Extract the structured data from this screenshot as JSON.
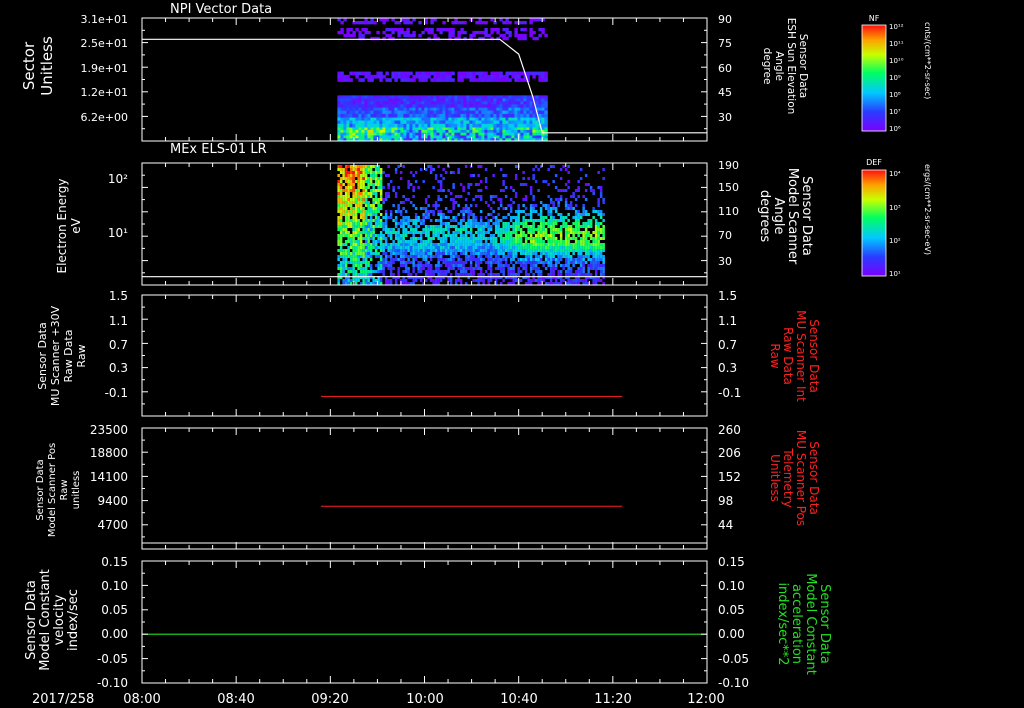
{
  "footer": {
    "date_label": "2017/258",
    "time_ticks": [
      "08:00",
      "08:40",
      "09:20",
      "10:00",
      "10:40",
      "11:20",
      "12:00"
    ]
  },
  "panels": [
    {
      "title": "NPI Vector Data",
      "left_label": [
        "Sector",
        "Unitless"
      ],
      "left_ticks": [
        "3.1e+01",
        "2.5e+01",
        "1.9e+01",
        "1.2e+01",
        "6.2e+00"
      ],
      "right_label": [
        "Sensor Data",
        "ESH Sun Elevation",
        "Angle",
        "degree"
      ],
      "right_ticks": [
        "90",
        "75",
        "60",
        "45",
        "30"
      ],
      "colorbar": {
        "label": "NF",
        "unit": "cnts/(cm**2-sr-sec)",
        "ticks": [
          "10¹²",
          "10¹¹",
          "10¹⁰",
          "10⁹",
          "10⁸",
          "10⁷",
          "10⁶"
        ]
      }
    },
    {
      "title": "MEx ELS-01 LR",
      "left_label": [
        "Electron Energy",
        "eV"
      ],
      "left_ticks": [
        "10²",
        "10¹"
      ],
      "right_label": [
        "Sensor Data",
        "Model Scanner",
        "Angle",
        "degrees"
      ],
      "right_ticks": [
        "190",
        "150",
        "110",
        "70",
        "30"
      ],
      "colorbar": {
        "label": "DEF",
        "unit": "ergs/(cm**2-sr-sec-eV)",
        "ticks": [
          "10⁴",
          "10³",
          "10²",
          "10¹"
        ]
      }
    },
    {
      "left_label": [
        "Sensor Data",
        "MU Scanner +30V",
        "Raw Data",
        "Raw"
      ],
      "left_ticks": [
        "1.5",
        "1.1",
        "0.7",
        "0.3",
        "-0.1"
      ],
      "right_label": [
        "Sensor Data",
        "MU Scanner Int",
        "Raw Data",
        "Raw"
      ],
      "right_ticks": [
        "1.5",
        "1.1",
        "0.7",
        "0.3",
        "-0.1"
      ]
    },
    {
      "left_label": [
        "Sensor Data",
        "Model Scanner Pos",
        "Raw",
        "unitless"
      ],
      "left_ticks": [
        "23500",
        "18800",
        "14100",
        "9400",
        "4700"
      ],
      "right_label": [
        "Sensor Data",
        "MU Scanner Pos",
        "Telemetry",
        "Unitless"
      ],
      "right_ticks": [
        "260",
        "206",
        "152",
        "98",
        "44"
      ]
    },
    {
      "left_label": [
        "Sensor Data",
        "Model Constant",
        "velocity",
        "index/sec"
      ],
      "left_ticks": [
        "0.15",
        "0.10",
        "0.05",
        "0.00",
        "-0.05",
        "-0.10"
      ],
      "right_label": [
        "Sensor Data",
        "Model Constant",
        "acceleration",
        "index/sec**2"
      ],
      "right_ticks": [
        "0.15",
        "0.10",
        "0.05",
        "0.00",
        "-0.05",
        "-0.10"
      ]
    }
  ],
  "colors": {
    "red_series": "#ff2020",
    "green_series": "#22e022",
    "white_series": "#ffffff"
  },
  "chart_data": [
    {
      "type": "heatmap",
      "x_range": [
        "08:00",
        "12:00"
      ],
      "ylim": [
        0,
        31
      ],
      "data_time_range": [
        "09:23",
        "10:52"
      ],
      "overlay_line": {
        "name": "ESH Sun Elevation Angle",
        "y2lim": [
          15,
          90
        ],
        "x": [
          "08:00",
          "10:32",
          "10:40",
          "10:46",
          "10:50",
          "12:00"
        ],
        "y": [
          77,
          77,
          68,
          42,
          20,
          20
        ]
      }
    },
    {
      "type": "heatmap",
      "x_range": [
        "08:00",
        "12:00"
      ],
      "y_log": true,
      "ylim": [
        2,
        180
      ],
      "data_time_range": [
        "09:23",
        "11:16"
      ],
      "overlay_line": {
        "name": "Model Scanner Angle",
        "y2lim": [
          0,
          190
        ],
        "x": [
          "08:00",
          "12:00"
        ],
        "y": [
          13,
          13
        ]
      }
    },
    {
      "type": "line",
      "x": [
        "09:16",
        "11:24"
      ],
      "y": [
        -0.05,
        -0.05
      ],
      "ylim": [
        -0.35,
        1.5
      ]
    },
    {
      "type": "line",
      "x": [
        "09:16",
        "11:24"
      ],
      "y": [
        8300,
        8300
      ],
      "ylim": [
        0,
        23500
      ]
    },
    {
      "type": "line",
      "x": [
        "08:00",
        "12:00"
      ],
      "y": [
        0.0,
        0.0
      ],
      "ylim": [
        -0.1,
        0.15
      ]
    }
  ]
}
